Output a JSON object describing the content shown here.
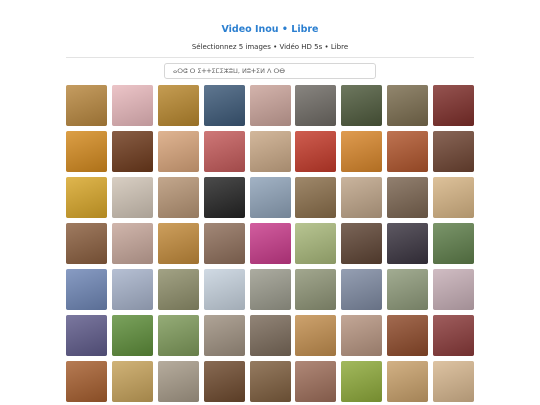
{
  "header": {
    "title": "Video Inou • Libre",
    "subtitle": "Sélectionnez 5 images • Vidéo HD 5s • Libre"
  },
  "search": {
    "placeholder": "ⴰⵔⵛ ⵔ ⵉⵜⵜⵉⵎⵉⵣⵓⵡ, ⵍⵓⵜⵉⵍ ⴷ ⵔⴱ"
  },
  "images": [
    {
      "name": "birds-on-branch",
      "color": "#b8873e"
    },
    {
      "name": "pink-flowers",
      "color": "#e8b8bc"
    },
    {
      "name": "desert-camel",
      "color": "#b8872d"
    },
    {
      "name": "blue-door",
      "color": "#3c5978"
    },
    {
      "name": "hands-henna",
      "color": "#caa39a"
    },
    {
      "name": "wolf",
      "color": "#6e6a64"
    },
    {
      "name": "rooster",
      "color": "#4e5a3c"
    },
    {
      "name": "man-with-staff",
      "color": "#7a6c4e"
    },
    {
      "name": "spices-red",
      "color": "#7e2e2a"
    },
    {
      "name": "oranges-basket",
      "color": "#d48a1e"
    },
    {
      "name": "tagine-fire",
      "color": "#6e3a1c"
    },
    {
      "name": "bread-hands",
      "color": "#d8a47a"
    },
    {
      "name": "market-stall",
      "color": "#c45a5a"
    },
    {
      "name": "woman-portrait",
      "color": "#c9a886"
    },
    {
      "name": "woman-red-scarf",
      "color": "#c43a2a"
    },
    {
      "name": "woman-headdress",
      "color": "#d8862a"
    },
    {
      "name": "couscous-dish",
      "color": "#b0552c"
    },
    {
      "name": "market-shelves",
      "color": "#6e4432"
    },
    {
      "name": "ornate-plate",
      "color": "#d8a628"
    },
    {
      "name": "weaving",
      "color": "#d0c4b6"
    },
    {
      "name": "baskets",
      "color": "#b69474"
    },
    {
      "name": "dark-arch",
      "color": "#242424"
    },
    {
      "name": "mountain-road",
      "color": "#8ea2b8"
    },
    {
      "name": "clay-oven",
      "color": "#8a6e4a"
    },
    {
      "name": "pottery",
      "color": "#bea488"
    },
    {
      "name": "doorway-light",
      "color": "#7a6450"
    },
    {
      "name": "pastry-plate",
      "color": "#d6b484"
    },
    {
      "name": "souk-street",
      "color": "#8a5e3e"
    },
    {
      "name": "decor-items",
      "color": "#c6a69a"
    },
    {
      "name": "vegetables",
      "color": "#c28a3a"
    },
    {
      "name": "clay-jugs",
      "color": "#8e6e5a"
    },
    {
      "name": "flowers-colorful",
      "color": "#c83a8a"
    },
    {
      "name": "melons",
      "color": "#a8b87a"
    },
    {
      "name": "rug-shop",
      "color": "#5e4434"
    },
    {
      "name": "silver-jewelry",
      "color": "#3a3440"
    },
    {
      "name": "green-valley",
      "color": "#5e7e4a"
    },
    {
      "name": "village-hills",
      "color": "#6e86b6"
    },
    {
      "name": "blossom-tree",
      "color": "#a6b2ca"
    },
    {
      "name": "terrace-fields",
      "color": "#8e8e6a"
    },
    {
      "name": "snowy-forest",
      "color": "#c6d2de"
    },
    {
      "name": "stone-mill",
      "color": "#9a9a8c"
    },
    {
      "name": "mountains",
      "color": "#8e9476"
    },
    {
      "name": "valley-road",
      "color": "#7e8aa2"
    },
    {
      "name": "plains-green",
      "color": "#8e9a7a"
    },
    {
      "name": "almond-blossom",
      "color": "#c6aeb6"
    },
    {
      "name": "pomegranate",
      "color": "#5e5a8a"
    },
    {
      "name": "green-leaves",
      "color": "#5e8e3a"
    },
    {
      "name": "hillside-field",
      "color": "#7e9a5a"
    },
    {
      "name": "desert-mountains",
      "color": "#9e9080"
    },
    {
      "name": "canyon",
      "color": "#7a6a5a"
    },
    {
      "name": "dunes",
      "color": "#c28e4e"
    },
    {
      "name": "bread-oven",
      "color": "#b69480"
    },
    {
      "name": "lanterns",
      "color": "#8e4a2a"
    },
    {
      "name": "red-table",
      "color": "#8a3a3a"
    },
    {
      "name": "hanging-goods",
      "color": "#a65e2e"
    },
    {
      "name": "glasses-tea",
      "color": "#c6a25a"
    },
    {
      "name": "clay-pot",
      "color": "#a69a88"
    },
    {
      "name": "dates-tray",
      "color": "#6e4a2e"
    },
    {
      "name": "kitchen-scene",
      "color": "#7e5e3e"
    },
    {
      "name": "fabric-display",
      "color": "#9e6e5a"
    },
    {
      "name": "grapes",
      "color": "#8eaa3a"
    },
    {
      "name": "festive-dish",
      "color": "#c8a06a"
    },
    {
      "name": "round-platter",
      "color": "#d6b68e"
    }
  ]
}
